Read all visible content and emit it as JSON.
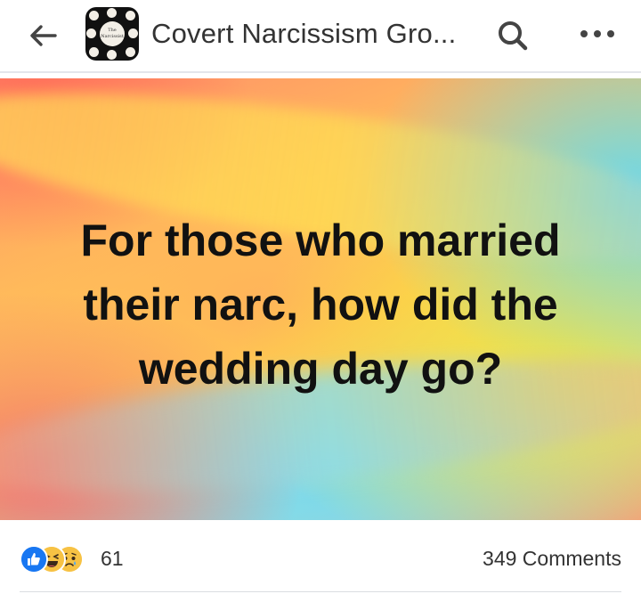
{
  "header": {
    "back_icon": "arrow-left-icon",
    "group_name": "Covert Narcissism Gro...",
    "avatar_text": "The Narcissist",
    "search_icon": "search-icon",
    "more_icon": "more-horizontal-icon"
  },
  "post": {
    "text": "For those who married their narc, how did the wedding day go?",
    "background_colors": [
      "#ff6f5a",
      "#ffc05a",
      "#f6e33c",
      "#7fd9e9",
      "#f47272"
    ]
  },
  "footer": {
    "reaction_icons": [
      "like-icon",
      "haha-icon",
      "sad-icon"
    ],
    "reaction_count": "61",
    "comments_label": "349 Comments"
  },
  "colors": {
    "like_blue": "#1877f2",
    "emoji_yellow": "#f7c244",
    "text_dark": "#333333"
  }
}
